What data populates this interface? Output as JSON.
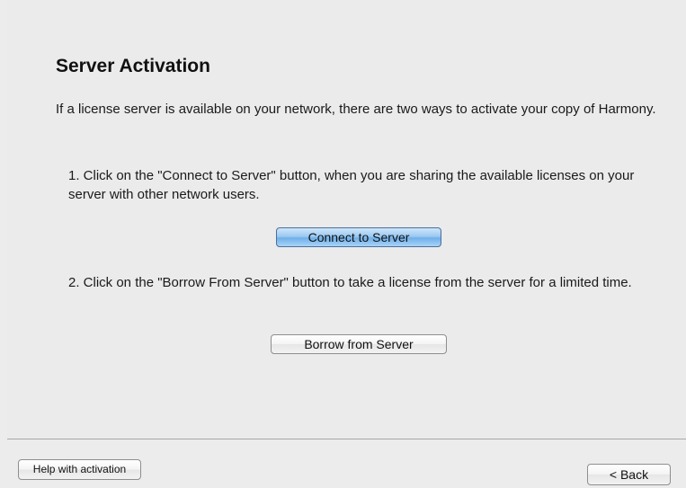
{
  "page": {
    "title": "Server Activation",
    "intro": "If a license server is available on your network, there are two ways to activate your copy of Harmony.",
    "step1_text": "1. Click on the \"Connect to Server\" button, when you are sharing the available licenses on your server with other network users.",
    "connect_label": "Connect to Server",
    "step2_text": "2. Click on the \"Borrow From Server\" button to take a license from the server for a limited time.",
    "borrow_label": "Borrow from Server"
  },
  "footer": {
    "help_label": "Help with activation",
    "back_label": "< Back"
  }
}
